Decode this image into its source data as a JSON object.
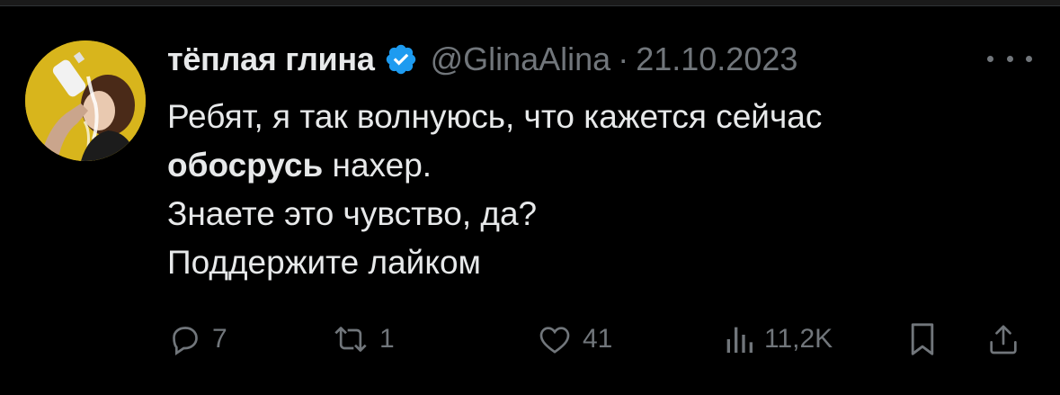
{
  "tweet": {
    "display_name": "тёплая глина",
    "handle": "@GlinaAlina",
    "separator": "·",
    "date": "21.10.2023",
    "text_lines": [
      {
        "before": "Ребят, я так волнуюсь, что кажется сейчас",
        "bold": "",
        "after": ""
      },
      {
        "before": "",
        "bold": "обосрусь",
        "after": " нахер."
      },
      {
        "before": "Знаете это чувство, да?",
        "bold": "",
        "after": ""
      },
      {
        "before": "Поддержите лайком",
        "bold": "",
        "after": ""
      }
    ]
  },
  "actions": {
    "reply_count": "7",
    "retweet_count": "1",
    "like_count": "41",
    "views_count": "11,2K"
  },
  "icons": {
    "verified": "verified-badge-icon",
    "more": "more-dots-icon",
    "reply": "reply-icon",
    "retweet": "retweet-icon",
    "like": "heart-icon",
    "views": "views-chart-icon",
    "bookmark": "bookmark-icon",
    "share": "share-icon"
  },
  "colors": {
    "background": "#000000",
    "text": "#e7e9ea",
    "secondary": "#71767b",
    "verified": "#1d9bf0",
    "avatar_bg": "#d8b51c"
  }
}
